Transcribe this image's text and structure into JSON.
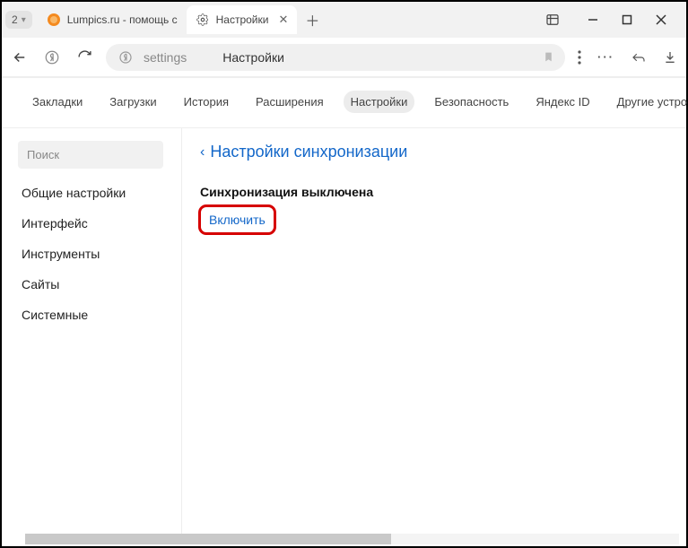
{
  "tabs": {
    "counter": "2",
    "tab1_label": "Lumpics.ru - помощь с",
    "tab2_label": "Настройки"
  },
  "addressbar": {
    "url_text": "settings",
    "page_title": "Настройки"
  },
  "topnav": {
    "bookmarks": "Закладки",
    "downloads": "Загрузки",
    "history": "История",
    "extensions": "Расширения",
    "settings": "Настройки",
    "security": "Безопасность",
    "yandex_id": "Яндекс ID",
    "other_devices": "Другие устройства"
  },
  "sidebar": {
    "search_placeholder": "Поиск",
    "items": {
      "general": "Общие настройки",
      "interface": "Интерфейс",
      "tools": "Инструменты",
      "sites": "Сайты",
      "system": "Системные"
    }
  },
  "content": {
    "heading": "Настройки синхронизации",
    "sub": "Синхронизация выключена",
    "enable": "Включить"
  }
}
